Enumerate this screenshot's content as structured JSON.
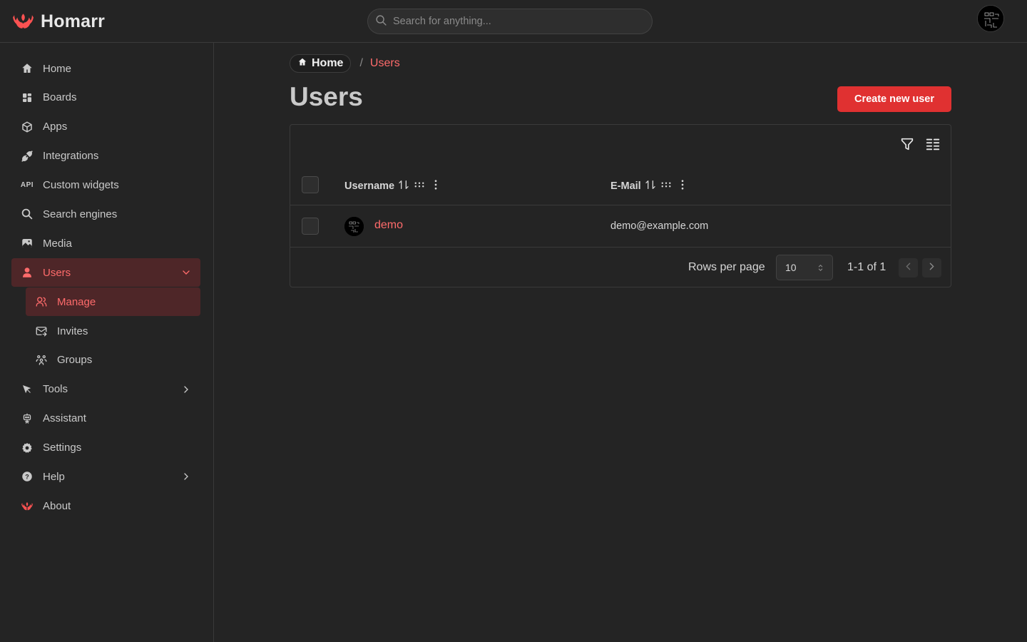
{
  "app": {
    "name": "Homarr",
    "brand_color": "#fa5252"
  },
  "search": {
    "placeholder": "Search for anything..."
  },
  "sidebar": {
    "items": [
      {
        "label": "Home",
        "icon": "home-icon"
      },
      {
        "label": "Boards",
        "icon": "layout-dashboard-icon"
      },
      {
        "label": "Apps",
        "icon": "box-icon"
      },
      {
        "label": "Integrations",
        "icon": "plug-connected-icon"
      },
      {
        "label": "Custom widgets",
        "icon": "api-icon",
        "icon_text": "API"
      },
      {
        "label": "Search engines",
        "icon": "search-icon"
      },
      {
        "label": "Media",
        "icon": "photo-icon"
      },
      {
        "label": "Users",
        "icon": "user-icon",
        "active": true,
        "expanded": true
      },
      {
        "label": "Tools",
        "icon": "pointer-icon"
      },
      {
        "label": "Assistant",
        "icon": "robot-icon"
      },
      {
        "label": "Settings",
        "icon": "settings-icon"
      },
      {
        "label": "Help",
        "icon": "question-mark-icon"
      },
      {
        "label": "About",
        "icon": "homarr-logo-icon"
      }
    ],
    "users_sub": [
      {
        "label": "Manage",
        "icon": "users-icon",
        "active": true
      },
      {
        "label": "Invites",
        "icon": "mail-forward-icon"
      },
      {
        "label": "Groups",
        "icon": "users-group-icon"
      }
    ]
  },
  "breadcrumb": {
    "home": "Home",
    "separator": "/",
    "current": "Users"
  },
  "page": {
    "title": "Users",
    "create_button": "Create new user"
  },
  "table": {
    "columns": [
      "Username",
      "E-Mail"
    ],
    "rows": [
      {
        "username": "demo",
        "email": "demo@example.com"
      }
    ],
    "rows_per_page_label": "Rows per page",
    "rows_per_page": "10",
    "range": "1-1 of 1"
  },
  "colors": {
    "accent": "#ff6b6b",
    "button": "#e03131",
    "active_bg": "#4e2628",
    "background": "#242424"
  }
}
